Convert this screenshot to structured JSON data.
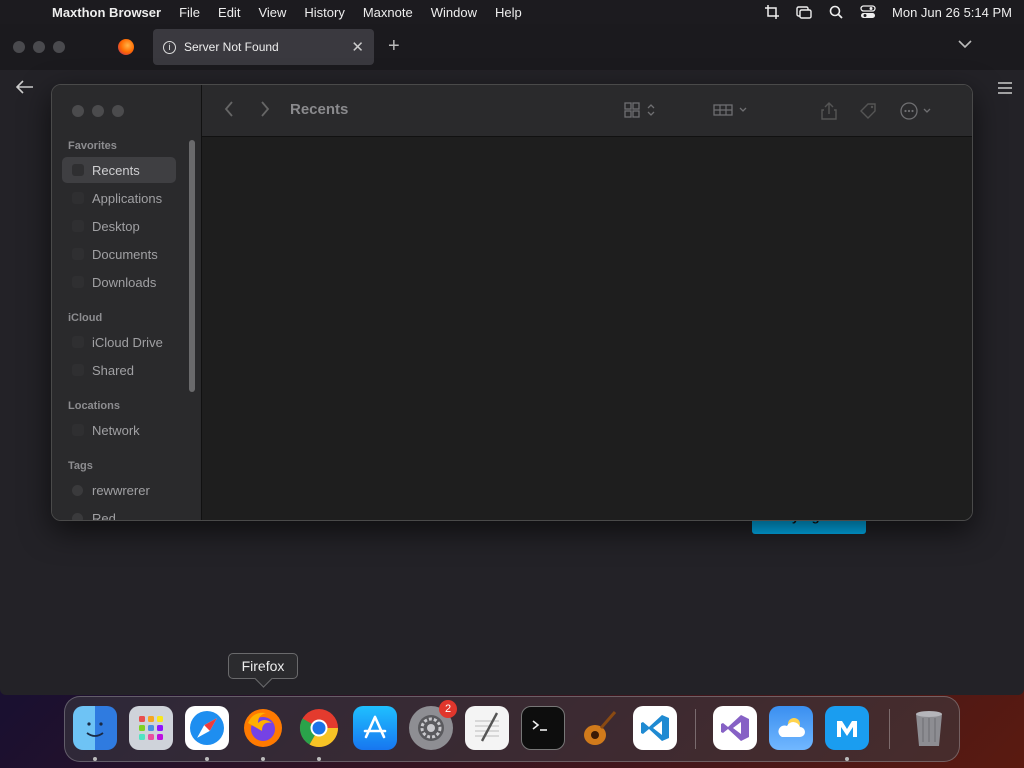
{
  "menubar": {
    "app_name": "Maxthon Browser",
    "items": [
      "File",
      "Edit",
      "View",
      "History",
      "Maxnote",
      "Window",
      "Help"
    ],
    "datetime": "Mon Jun 26  5:14 PM"
  },
  "browser": {
    "tab_title": "Server Not Found",
    "try_again_label": "Try Again"
  },
  "finder": {
    "title": "Recents",
    "sections": {
      "favorites": "Favorites",
      "icloud": "iCloud",
      "locations": "Locations",
      "tags": "Tags"
    },
    "favorites": [
      "Recents",
      "Applications",
      "Desktop",
      "Documents",
      "Downloads"
    ],
    "icloud": [
      "iCloud Drive",
      "Shared"
    ],
    "locations": [
      "Network"
    ],
    "tags": [
      "rewwrerer",
      "Red"
    ]
  },
  "tooltip": "Firefox",
  "dock": {
    "system_settings_badge": "2",
    "apps": [
      "Finder",
      "Launchpad",
      "Safari",
      "Firefox",
      "Chrome",
      "App Store",
      "System Settings",
      "TextEdit",
      "Terminal",
      "GarageBand",
      "VS Code",
      "Visual Studio",
      "Weather",
      "Maxthon",
      "Trash"
    ]
  },
  "colors": {
    "accent": "#00b3f4",
    "badge": "#e0362c"
  }
}
